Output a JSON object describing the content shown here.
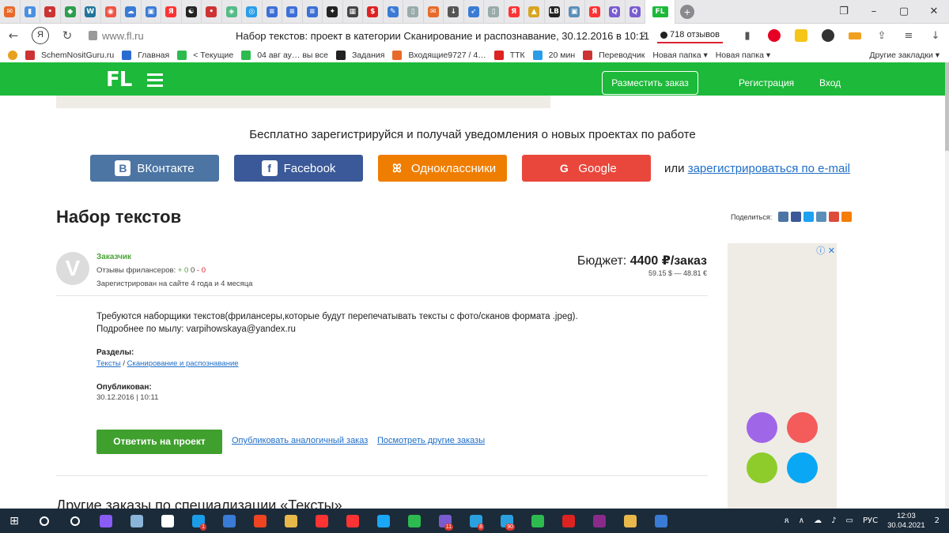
{
  "browser": {
    "tabs": [
      {
        "icon": "mail-icon",
        "color": "#e86a2a",
        "letter": "✉"
      },
      {
        "icon": "chart-icon",
        "color": "#4a90e2",
        "letter": "▮"
      },
      {
        "icon": "dots-icon",
        "color": "#c33",
        "letter": "•"
      },
      {
        "icon": "leaf-icon",
        "color": "#2e9e4e",
        "letter": "◆"
      },
      {
        "icon": "wordpress-icon",
        "color": "#21759b",
        "letter": "W"
      },
      {
        "icon": "paint-icon",
        "color": "#e54",
        "letter": "◉"
      },
      {
        "icon": "cloud-icon",
        "color": "#3a7bd5",
        "letter": "☁"
      },
      {
        "icon": "bookmark-icon",
        "color": "#3a7bd5",
        "letter": "▣"
      },
      {
        "icon": "yandex-icon",
        "color": "#f33",
        "letter": "Я"
      },
      {
        "icon": "yin-yang-icon",
        "color": "#222",
        "letter": "☯"
      },
      {
        "icon": "dots-icon",
        "color": "#c33",
        "letter": "•"
      },
      {
        "icon": "shield-icon",
        "color": "#5b8",
        "letter": "◈"
      },
      {
        "icon": "globe-icon",
        "color": "#2a9de8",
        "letter": "◎"
      },
      {
        "icon": "doc-icon",
        "color": "#3c6fd6",
        "letter": "≡"
      },
      {
        "icon": "doc-icon",
        "color": "#3c6fd6",
        "letter": "≡"
      },
      {
        "icon": "doc-icon",
        "color": "#3c6fd6",
        "letter": "≡"
      },
      {
        "icon": "compass-icon",
        "color": "#222",
        "letter": "✦"
      },
      {
        "icon": "grid-icon",
        "color": "#444",
        "letter": "▦"
      },
      {
        "icon": "dollar-icon",
        "color": "#d22",
        "letter": "$"
      },
      {
        "icon": "edit-icon",
        "color": "#3a7bd5",
        "letter": "✎"
      },
      {
        "icon": "page-icon",
        "color": "#9aa",
        "letter": "▯"
      },
      {
        "icon": "mail-icon",
        "color": "#e86a2a",
        "letter": "✉"
      },
      {
        "icon": "download-icon",
        "color": "#555",
        "letter": "↓"
      },
      {
        "icon": "feather-icon",
        "color": "#3a7bd5",
        "letter": "➶"
      },
      {
        "icon": "page-icon",
        "color": "#9aa",
        "letter": "▯"
      },
      {
        "icon": "yandex-icon",
        "color": "#f33",
        "letter": "Я"
      },
      {
        "icon": "image-icon",
        "color": "#d9a520",
        "letter": "▲"
      },
      {
        "icon": "lb-icon",
        "color": "#222",
        "letter": "LB"
      },
      {
        "icon": "image-icon",
        "color": "#5b8fb9",
        "letter": "▣"
      },
      {
        "icon": "yandex-icon",
        "color": "#f33",
        "letter": "Я"
      },
      {
        "icon": "search-icon",
        "color": "#7a5cd0",
        "letter": "Q"
      },
      {
        "icon": "search-icon",
        "color": "#7a5cd0",
        "letter": "Q"
      }
    ],
    "active_tab_label": "FL",
    "url": "www.fl.ru",
    "title": "Набор текстов: проект в категории Сканирование и распознавание, 30.12.2016 в 10:11",
    "reviews_badge": "718 отзывов",
    "ya_label": "Я",
    "page_badge": "2",
    "bookmarks": [
      {
        "label": "SchemNositGuru.ru",
        "color": "#c33"
      },
      {
        "label": "Главная",
        "color": "#2a6bd0"
      },
      {
        "label": "< Текущие",
        "color": "#2dbb4f"
      },
      {
        "label": "04 авг ау… вы все",
        "color": "#2dbb4f"
      },
      {
        "label": "Задания",
        "color": "#222"
      },
      {
        "label": "Входящие9727 / 4…",
        "color": "#e86a2a"
      },
      {
        "label": "ТТК",
        "color": "#d22"
      },
      {
        "label": "20 мин",
        "color": "#2a9de8"
      },
      {
        "label": "Переводчик",
        "color": "#c33"
      },
      {
        "label": "Новая папка ▾",
        "color": ""
      },
      {
        "label": "Новая папка ▾",
        "color": ""
      }
    ],
    "other_bookmarks": "Другие закладки ▾"
  },
  "site": {
    "logo": "FL",
    "place_order": "Разместить заказ",
    "register": "Регистрация",
    "login": "Вход",
    "promo": "Бесплатно зарегистрируйся и получай уведомления о новых проектах по работе",
    "social": {
      "vk": {
        "label": "ВКонтакте",
        "glyph": "B"
      },
      "fb": {
        "label": "Facebook",
        "glyph": "f"
      },
      "ok": {
        "label": "Одноклассники",
        "glyph": "ꕤ"
      },
      "google": {
        "label": "Google",
        "glyph": "G"
      }
    },
    "or_text": "или ",
    "email_reg": "зарегистрироваться по e-mail",
    "share_label": "Поделиться:"
  },
  "project": {
    "title": "Набор текстов",
    "avatar_letter": "V",
    "customer_label": "Заказчик",
    "reviews_label": "Отзывы фрилансеров: ",
    "reviews_pos": "+ 0",
    "reviews_zero": " 0 ",
    "reviews_neg": "- 0",
    "registered": "Зарегистрирован на сайте 4 года и 4 месяца",
    "budget_label": "Бюджет: ",
    "budget_value": "4400 ₽/заказ",
    "budget_conv": "59.15 $ — 48.81 €",
    "desc_line1": "Требуются наборщики текстов(фрилансеры,которые будут перепечатывать тексты с фото/сканов формата .jpeg).",
    "desc_line2": "Подробнее по мылу: varpihowskaya@yandex.ru",
    "sections_label": "Разделы:",
    "section_1": "Тексты",
    "section_sep": " / ",
    "section_2": "Сканирование и распознавание",
    "published_label": "Опубликован:",
    "published_date": "30.12.2016 | 10:11",
    "reply_button": "Ответить на проект",
    "publish_similar": "Опубликовать аналогичный заказ",
    "see_other": "Посмотреть другие заказы",
    "other_heading": "Другие заказы по специализации «Тексты»"
  },
  "ad": {
    "icons": "ⓘ ✕",
    "dots": [
      "#a066e8",
      "#f45b5b",
      "#8dcc2b",
      "#0aa7f5"
    ]
  },
  "taskbar": {
    "apps": [
      {
        "name": "search-icon",
        "color": "#fff"
      },
      {
        "name": "task-view-icon",
        "color": "#fff"
      },
      {
        "name": "alice-icon",
        "color": "#8a5cf6"
      },
      {
        "name": "notes-icon",
        "color": "#8ab4d8"
      },
      {
        "name": "store-icon",
        "color": "#fff"
      },
      {
        "name": "skype-icon",
        "color": "#1a9de8",
        "badge": "1"
      },
      {
        "name": "mail-icon",
        "color": "#3a7bd5"
      },
      {
        "name": "opera-icon",
        "color": "#e42"
      },
      {
        "name": "folder-icon",
        "color": "#e8b84a"
      },
      {
        "name": "yandex-icon",
        "color": "#f33"
      },
      {
        "name": "yandex-browser-icon",
        "color": "#f33"
      },
      {
        "name": "bolt-icon",
        "color": "#1aa7f5"
      },
      {
        "name": "whatsapp-icon",
        "color": "#2dbb4f"
      },
      {
        "name": "viber-icon",
        "color": "#7a5cd0",
        "badge": "11"
      },
      {
        "name": "telegram-icon",
        "color": "#2aa0e0",
        "badge": "8"
      },
      {
        "name": "telegram-icon",
        "color": "#2aa0e0",
        "badge": "90"
      },
      {
        "name": "evernote-icon",
        "color": "#2dbb4f"
      },
      {
        "name": "filezilla-icon",
        "color": "#d22"
      },
      {
        "name": "winrar-icon",
        "color": "#8a2a8a"
      },
      {
        "name": "chrome-icon",
        "color": "#e8b84a"
      },
      {
        "name": "photos-icon",
        "color": "#3a7bd5"
      }
    ],
    "lang": "РУС",
    "time": "12:03",
    "date": "30.04.2021",
    "notification_badge": "2"
  }
}
